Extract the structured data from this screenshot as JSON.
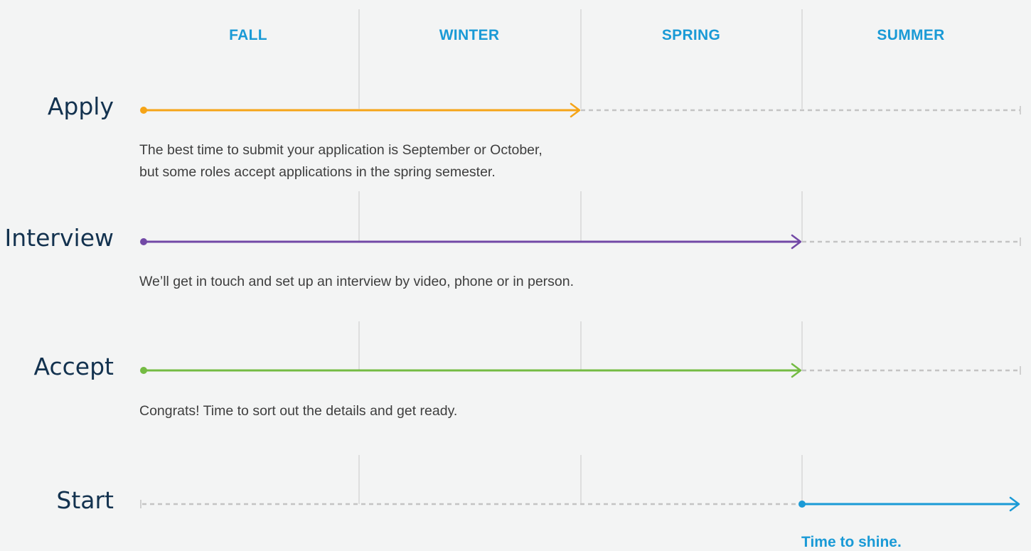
{
  "seasons": [
    "FALL",
    "WINTER",
    "SPRING",
    "SUMMER"
  ],
  "stages": [
    {
      "label": "Apply",
      "color": "#f5a417",
      "active_from": "FALL",
      "active_until": "SPRING",
      "description": [
        "The best time to submit your application is September or October,",
        "but some roles accept applications in the spring semester."
      ]
    },
    {
      "label": "Interview",
      "color": "#7249a6",
      "active_from": "FALL",
      "active_until": "SUMMER",
      "description": [
        "We’ll get in touch and set up an interview by video, phone or in person."
      ]
    },
    {
      "label": "Accept",
      "color": "#74bb43",
      "active_from": "FALL",
      "active_until": "SUMMER",
      "description": [
        "Congrats! Time to sort out the details and get ready."
      ]
    },
    {
      "label": "Start",
      "color": "#1a9ad6",
      "active_from": "SUMMER",
      "active_until": "end",
      "description": []
    }
  ],
  "start_tagline": "Time to shine.",
  "colors": {
    "background": "#f3f4f4",
    "season_text": "#1a9ad6",
    "label_text": "#13324f",
    "body_text": "#3e3e3e",
    "divider": "#cfcfcf",
    "dashed": "#c4c4c4"
  }
}
